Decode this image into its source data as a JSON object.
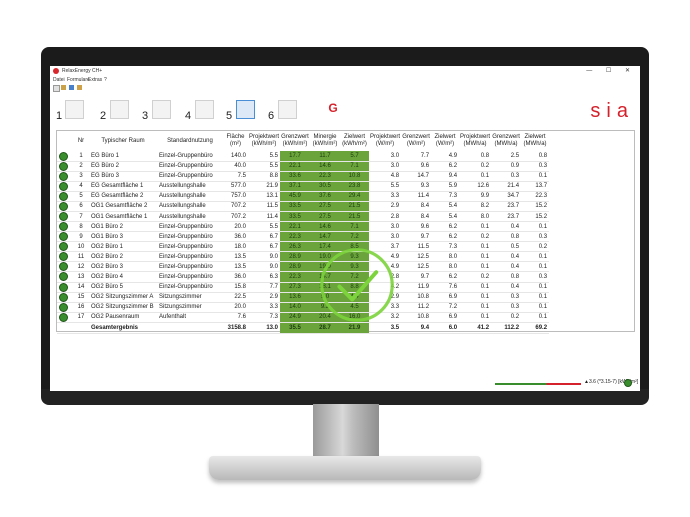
{
  "window": {
    "title": "RelaxEnergy CH+",
    "controls": "—  ☐  ✕"
  },
  "menu": [
    "Datei",
    "Formulare",
    "Extras",
    "?"
  ],
  "toolbar": {
    "numbers": [
      "1",
      "2",
      "3",
      "4",
      "5",
      "6"
    ],
    "g_label": "G",
    "brand": "sia"
  },
  "columns": [
    "",
    "Nr",
    "Typischer Raum",
    "Standardnutzung",
    "Fläche\n(m²)",
    "Projektwert\n(kWh/m²)",
    "Grenzwert\n(kWh/m²)",
    "Minergie\n(kWh/m²)",
    "Zielwert\n(kWh/m²)",
    "Projektwert\n(W/m²)",
    "Grenzwert\n(W/m²)",
    "Zielwert\n(W/m²)",
    "Projektwert\n(MWh/a)",
    "Grenzwert\n(MWh/a)",
    "Zielwert\n(MWh/a)"
  ],
  "rows": [
    [
      "1",
      "EG Büro 1",
      "Einzel-Gruppenbüro",
      "140.0",
      "5.5",
      "17.7",
      "11.7",
      "5.7",
      "3.0",
      "7.7",
      "4.9",
      "0.8",
      "2.5",
      "0.8"
    ],
    [
      "2",
      "EG Büro 2",
      "Einzel-Gruppenbüro",
      "40.0",
      "5.5",
      "22.1",
      "14.6",
      "7.1",
      "3.0",
      "9.6",
      "6.2",
      "0.2",
      "0.9",
      "0.3"
    ],
    [
      "3",
      "EG Büro 3",
      "Einzel-Gruppenbüro",
      "7.5",
      "8.8",
      "33.6",
      "22.3",
      "10.8",
      "4.8",
      "14.7",
      "9.4",
      "0.1",
      "0.3",
      "0.1"
    ],
    [
      "4",
      "EG Gesamtfläche 1",
      "Ausstellungshalle",
      "577.0",
      "21.9",
      "37.1",
      "30.5",
      "23.8",
      "5.5",
      "9.3",
      "5.9",
      "12.6",
      "21.4",
      "13.7"
    ],
    [
      "5",
      "EG Gesamtfläche 2",
      "Ausstellungshalle",
      "757.0",
      "13.1",
      "45.9",
      "37.6",
      "29.4",
      "3.3",
      "11.4",
      "7.3",
      "9.9",
      "34.7",
      "22.3"
    ],
    [
      "6",
      "OG1 Gesamtfläche 2",
      "Ausstellungshalle",
      "707.2",
      "11.5",
      "33.5",
      "27.5",
      "21.5",
      "2.9",
      "8.4",
      "5.4",
      "8.2",
      "23.7",
      "15.2"
    ],
    [
      "7",
      "OG1 Gesamtfläche 1",
      "Ausstellungshalle",
      "707.2",
      "11.4",
      "33.5",
      "27.5",
      "21.5",
      "2.8",
      "8.4",
      "5.4",
      "8.0",
      "23.7",
      "15.2"
    ],
    [
      "8",
      "OG1 Büro 2",
      "Einzel-Gruppenbüro",
      "20.0",
      "5.5",
      "22.1",
      "14.6",
      "7.1",
      "3.0",
      "9.6",
      "6.2",
      "0.1",
      "0.4",
      "0.1"
    ],
    [
      "9",
      "OG1 Büro 3",
      "Einzel-Gruppenbüro",
      "36.0",
      "6.7",
      "22.3",
      "14.7",
      "7.2",
      "3.0",
      "9.7",
      "6.2",
      "0.2",
      "0.8",
      "0.3"
    ],
    [
      "10",
      "OG2 Büro 1",
      "Einzel-Gruppenbüro",
      "18.0",
      "6.7",
      "26.3",
      "17.4",
      "8.5",
      "3.7",
      "11.5",
      "7.3",
      "0.1",
      "0.5",
      "0.2"
    ],
    [
      "11",
      "OG2 Büro 2",
      "Einzel-Gruppenbüro",
      "13.5",
      "9.0",
      "28.9",
      "19.0",
      "9.3",
      "4.9",
      "12.5",
      "8.0",
      "0.1",
      "0.4",
      "0.1"
    ],
    [
      "12",
      "OG2 Büro 3",
      "Einzel-Gruppenbüro",
      "13.5",
      "9.0",
      "28.9",
      "19.0",
      "9.3",
      "4.9",
      "12.5",
      "8.0",
      "0.1",
      "0.4",
      "0.1"
    ],
    [
      "13",
      "OG2 Büro 4",
      "Einzel-Gruppenbüro",
      "36.0",
      "6.3",
      "22.3",
      "14.7",
      "7.2",
      "2.8",
      "9.7",
      "6.2",
      "0.2",
      "0.8",
      "0.3"
    ],
    [
      "14",
      "OG2 Büro 5",
      "Einzel-Gruppenbüro",
      "15.8",
      "7.7",
      "27.3",
      "18.1",
      "8.8",
      "4.2",
      "11.9",
      "7.6",
      "0.1",
      "0.4",
      "0.1"
    ],
    [
      "15",
      "OG2 Sitzungszimmer A",
      "Sitzungszimmer",
      "22.5",
      "2.9",
      "13.6",
      "9.0",
      "4.4",
      "2.9",
      "10.8",
      "6.9",
      "0.1",
      "0.3",
      "0.1"
    ],
    [
      "16",
      "OG2 Sitzungszimmer B",
      "Sitzungszimmer",
      "20.0",
      "3.3",
      "14.0",
      "9.2",
      "4.5",
      "3.3",
      "11.2",
      "7.2",
      "0.1",
      "0.3",
      "0.1"
    ],
    [
      "17",
      "OG2 Pausenraum",
      "Aufenthalt",
      "7.6",
      "7.3",
      "24.9",
      "20.4",
      "16.0",
      "3.2",
      "10.8",
      "6.9",
      "0.1",
      "0.2",
      "0.1"
    ]
  ],
  "total": [
    "Gesamtergebnis",
    "3158.8",
    "13.0",
    "35.5",
    "28.7",
    "21.9",
    "3.5",
    "9.4",
    "6.0",
    "41.2",
    "112.2",
    "69.2"
  ],
  "status": {
    "text": "▲3.6 (*3.15-7) [kWh/m²]"
  }
}
